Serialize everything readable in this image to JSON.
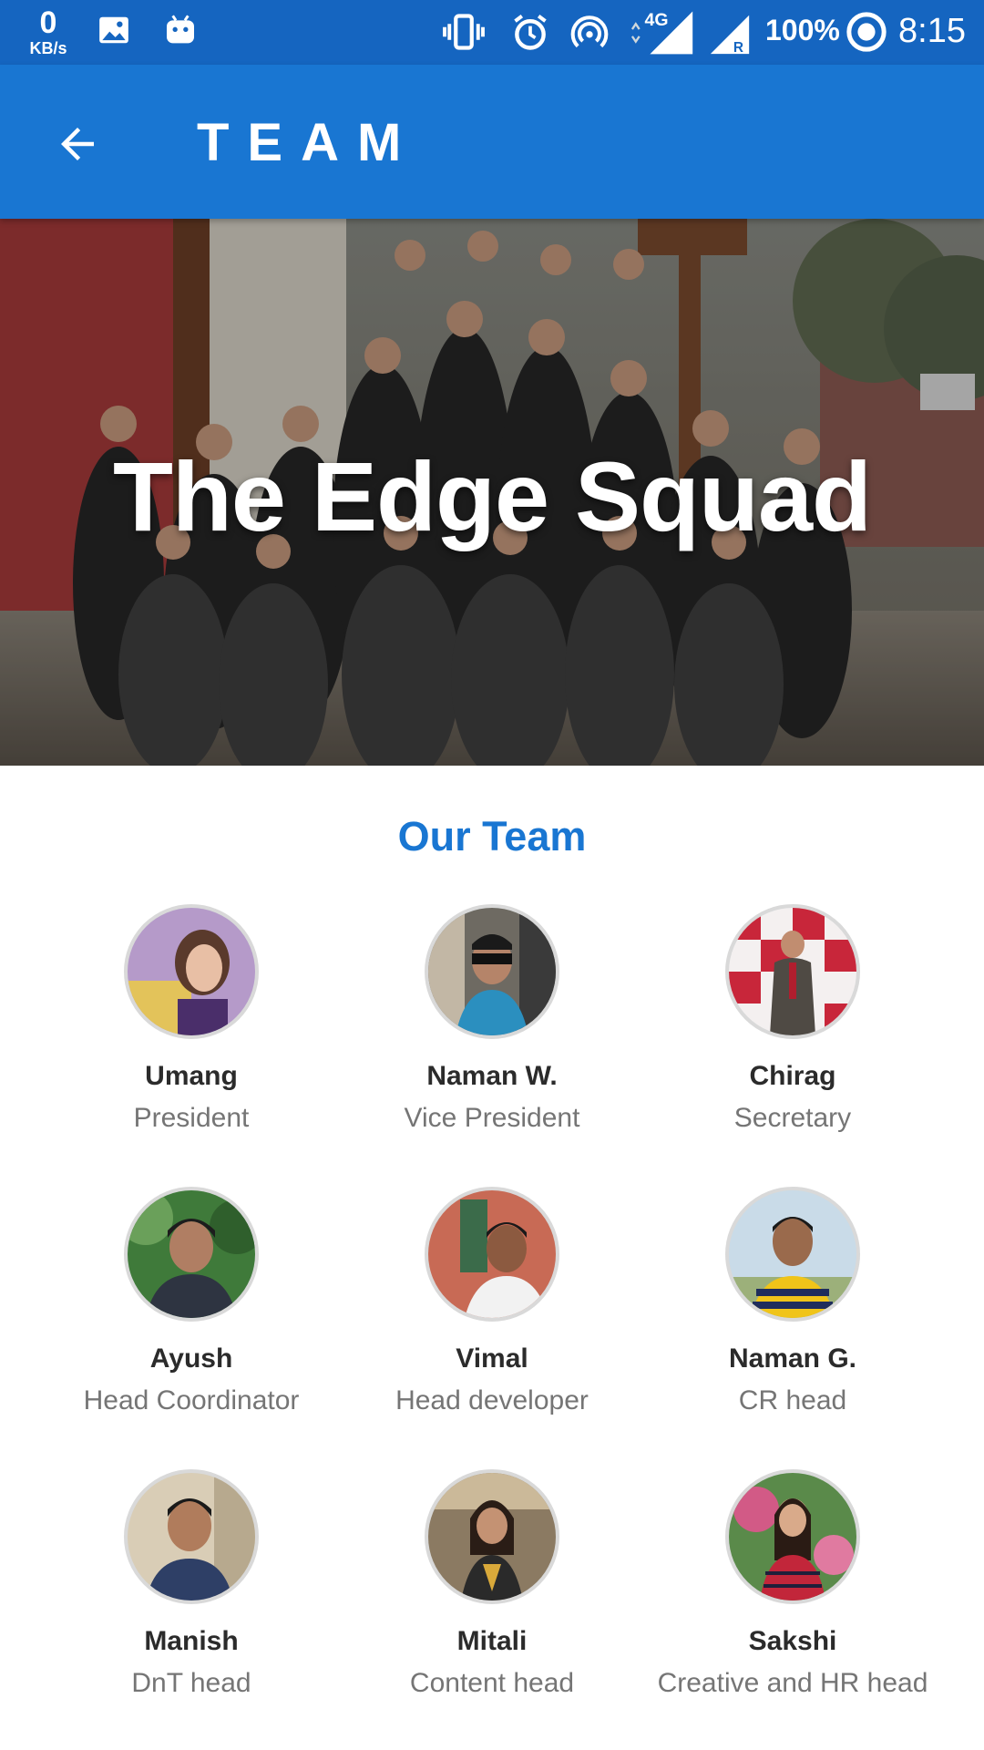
{
  "status_bar": {
    "net_speed": "0",
    "net_unit": "KB/s",
    "network_type": "4G",
    "battery": "100%",
    "time": "8:15",
    "icons": [
      "image-icon",
      "android-icon",
      "vibrate-icon",
      "alarm-icon",
      "hotspot-icon",
      "signal-icon",
      "signal-roaming-icon",
      "battery-saver-icon"
    ]
  },
  "app_bar": {
    "title": "TEAM",
    "back_icon": "arrow-back-icon"
  },
  "hero": {
    "title": "The Edge Squad"
  },
  "team": {
    "heading": "Our Team",
    "members": [
      {
        "name": "Umang",
        "role": "President"
      },
      {
        "name": "Naman W.",
        "role": "Vice President"
      },
      {
        "name": "Chirag",
        "role": "Secretary"
      },
      {
        "name": "Ayush",
        "role": "Head Coordinator"
      },
      {
        "name": "Vimal",
        "role": "Head developer"
      },
      {
        "name": "Naman G.",
        "role": "CR head"
      },
      {
        "name": "Manish",
        "role": "DnT head"
      },
      {
        "name": "Mitali",
        "role": "Content head"
      },
      {
        "name": "Sakshi",
        "role": "Creative and HR head"
      }
    ]
  },
  "colors": {
    "status_bar": "#1565c0",
    "app_bar": "#1976d2",
    "accent": "#1976d2"
  }
}
